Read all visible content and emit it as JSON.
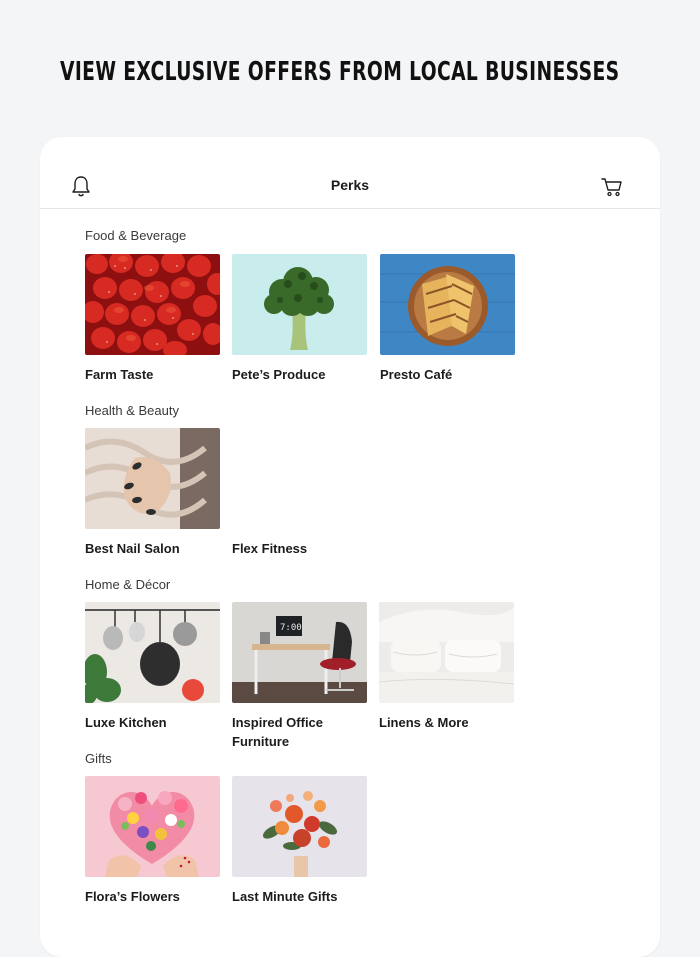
{
  "banner": {
    "title": "VIEW EXCLUSIVE OFFERS FROM LOCAL BUSINESSES",
    "icon": "cart-icon",
    "icon_color": "#3b82d6"
  },
  "app": {
    "title": "Perks",
    "left_icon": "bell-icon",
    "right_icon": "cart-icon"
  },
  "sections": [
    {
      "title": "Food & Beverage",
      "items": [
        {
          "name": "Farm Taste",
          "image": "strawberries"
        },
        {
          "name": "Pete’s Produce",
          "image": "broccoli"
        },
        {
          "name": "Presto Café",
          "image": "grilled-sandwich"
        }
      ]
    },
    {
      "title": "Health & Beauty",
      "items": [
        {
          "name": "Best Nail Salon",
          "image": "manicure-hand"
        },
        {
          "name": "Flex Fitness",
          "image": ""
        }
      ]
    },
    {
      "title": "Home & Décor",
      "items": [
        {
          "name": "Luxe Kitchen",
          "image": "hanging-pans"
        },
        {
          "name": "Inspired Office Furniture",
          "image": "desk-setup"
        },
        {
          "name": "Linens & More",
          "image": "white-bed"
        }
      ]
    },
    {
      "title": "Gifts",
      "items": [
        {
          "name": "Flora’s Flowers",
          "image": "heart-flowers"
        },
        {
          "name": "Last Minute Gifts",
          "image": "bouquet"
        }
      ]
    }
  ]
}
